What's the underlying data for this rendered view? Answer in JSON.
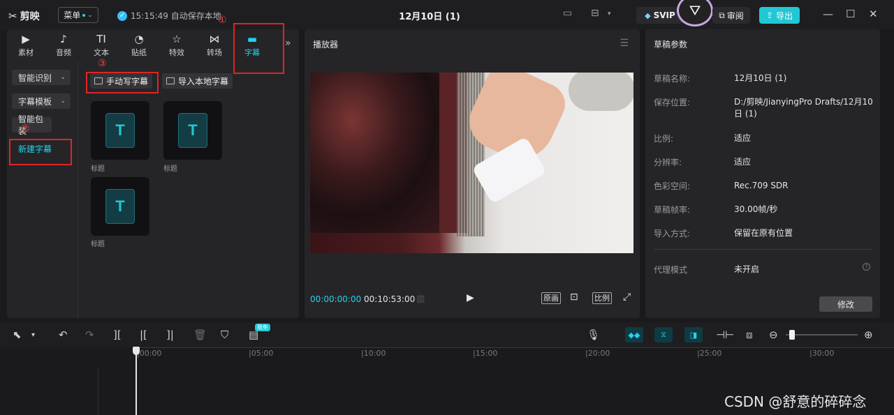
{
  "app": {
    "logo": "剪映",
    "menu_label": "菜单",
    "save_status": "15:15:49 自动保存本地",
    "doc_title": "12月10日 (1)",
    "svip_label": "SVIP",
    "review_label": "审阅",
    "export_label": "导出"
  },
  "media_tabs": [
    {
      "label": "素材",
      "icon": "media-icon"
    },
    {
      "label": "音频",
      "icon": "audio-icon"
    },
    {
      "label": "文本",
      "icon": "text-icon"
    },
    {
      "label": "贴纸",
      "icon": "sticker-icon"
    },
    {
      "label": "特效",
      "icon": "effects-icon"
    },
    {
      "label": "转场",
      "icon": "transition-icon"
    },
    {
      "label": "字幕",
      "icon": "subtitle-icon",
      "active": true
    }
  ],
  "subtitle_sidebar": {
    "items": [
      "智能识别",
      "字幕模板",
      "智能包装",
      "新建字幕"
    ]
  },
  "subtitle_actions": {
    "manual": "手动写字幕",
    "import": "导入本地字幕"
  },
  "templates": [
    "标题",
    "标题",
    "标题"
  ],
  "annotations": [
    "①",
    "②",
    "③"
  ],
  "player": {
    "title": "播放器",
    "current_time": "00:00:00:00",
    "total_time": "00:10:53:00",
    "original_label": "原画",
    "ratio_label": "比例"
  },
  "draft": {
    "title": "草稿参数",
    "rows": [
      {
        "key": "草稿名称:",
        "value": "12月10日 (1)"
      },
      {
        "key": "保存位置:",
        "value": "D:/剪映/JianyingPro Drafts/12月10日 (1)"
      },
      {
        "key": "比例:",
        "value": "适应"
      },
      {
        "key": "分辨率:",
        "value": "适应"
      },
      {
        "key": "色彩空间:",
        "value": "Rec.709 SDR"
      },
      {
        "key": "草稿帧率:",
        "value": "30.00帧/秒"
      },
      {
        "key": "导入方式:",
        "value": "保留在原有位置"
      }
    ],
    "proxy_key": "代理模式",
    "proxy_value": "未开启",
    "modify_label": "修改"
  },
  "timeline": {
    "limited_badge": "限免",
    "ticks": [
      "|00:00",
      "|05:00",
      "|10:00",
      "|15:00",
      "|20:00",
      "|25:00",
      "|30:00"
    ]
  },
  "watermark": "CSDN @舒意的碎碎念",
  "colors": {
    "accent": "#22d3ee",
    "annotation_red": "#e02424",
    "export_button": "#22c7d4"
  }
}
